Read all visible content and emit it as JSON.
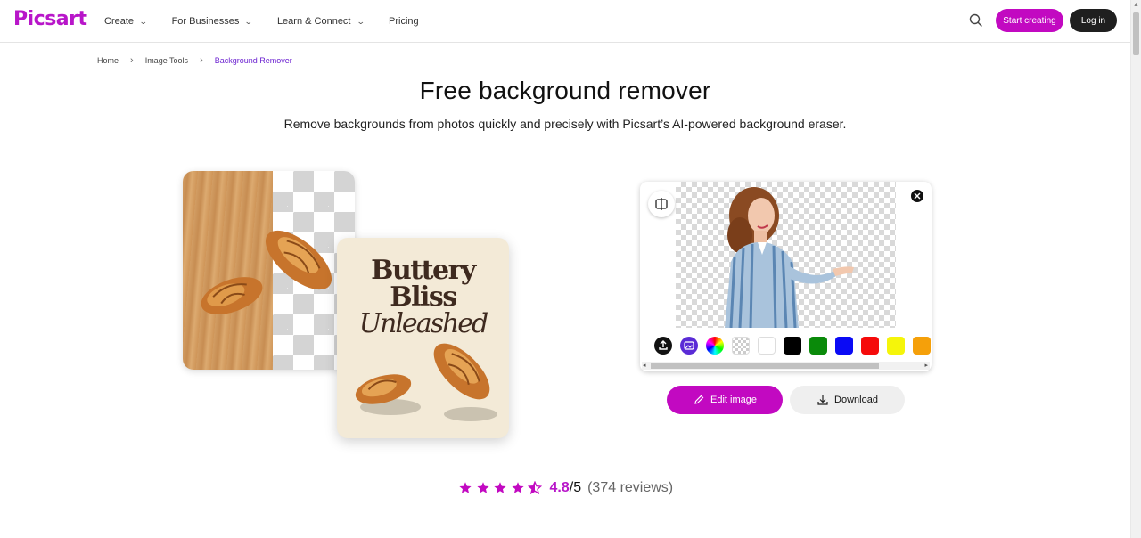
{
  "header": {
    "logo": "Picsart",
    "nav": [
      {
        "label": "Create"
      },
      {
        "label": "For Businesses"
      },
      {
        "label": "Learn & Connect"
      },
      {
        "label": "Pricing"
      }
    ],
    "start_label": "Start creating",
    "login_label": "Log in"
  },
  "breadcrumb": {
    "items": [
      "Home",
      "Image Tools",
      "Background Remover"
    ]
  },
  "hero": {
    "title": "Free background remover",
    "subtitle": "Remove backgrounds from photos quickly and precisely with Picsart’s AI-powered background eraser."
  },
  "illustration": {
    "poster_line1": "Buttery",
    "poster_line2": "Bliss",
    "poster_line3": "Unleashed"
  },
  "editor": {
    "swatch_colors": [
      "#ffffff",
      "#000000",
      "#0a8a0a",
      "#0a0af5",
      "#f50a0a",
      "#f5f50a",
      "#f5a00a"
    ],
    "edit_label": "Edit image",
    "download_label": "Download"
  },
  "rating": {
    "score": "4.8",
    "out_of": "/5",
    "reviews": "(374 reviews)",
    "stars": 4.5
  },
  "colors": {
    "brand": "#c209c1",
    "dark_button": "#1f1f1f",
    "breadcrumb_active": "#6a1fd0"
  }
}
